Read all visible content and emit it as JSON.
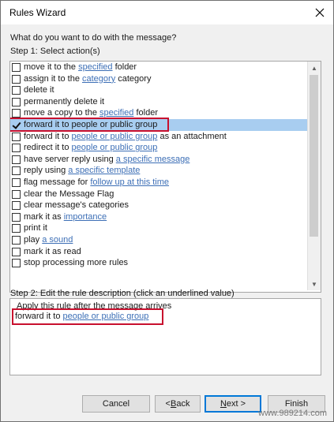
{
  "window": {
    "title": "Rules Wizard"
  },
  "question": "What do you want to do with the message?",
  "step1_label": "Step 1: Select action(s)",
  "actions": [
    {
      "pre": "move it to the ",
      "link": "specified",
      "post": " folder",
      "checked": false,
      "selected": false
    },
    {
      "pre": "assign it to the ",
      "link": "category",
      "post": " category",
      "checked": false,
      "selected": false
    },
    {
      "pre": "delete it",
      "link": "",
      "post": "",
      "checked": false,
      "selected": false
    },
    {
      "pre": "permanently delete it",
      "link": "",
      "post": "",
      "checked": false,
      "selected": false
    },
    {
      "pre": "move a copy to the ",
      "link": "specified",
      "post": " folder",
      "checked": false,
      "selected": false
    },
    {
      "pre": "forward it to people or public group",
      "link": "",
      "post": "",
      "checked": true,
      "selected": true
    },
    {
      "pre": "forward it to ",
      "link": "people or public group",
      "post": " as an attachment",
      "checked": false,
      "selected": false
    },
    {
      "pre": "redirect it to ",
      "link": "people or public group",
      "post": "",
      "checked": false,
      "selected": false
    },
    {
      "pre": "have server reply using ",
      "link": "a specific message",
      "post": "",
      "checked": false,
      "selected": false
    },
    {
      "pre": "reply using ",
      "link": "a specific template",
      "post": "",
      "checked": false,
      "selected": false
    },
    {
      "pre": "flag message for ",
      "link": "follow up at this time",
      "post": "",
      "checked": false,
      "selected": false
    },
    {
      "pre": "clear the Message Flag",
      "link": "",
      "post": "",
      "checked": false,
      "selected": false
    },
    {
      "pre": "clear message's categories",
      "link": "",
      "post": "",
      "checked": false,
      "selected": false
    },
    {
      "pre": "mark it as ",
      "link": "importance",
      "post": "",
      "checked": false,
      "selected": false
    },
    {
      "pre": "print it",
      "link": "",
      "post": "",
      "checked": false,
      "selected": false
    },
    {
      "pre": "play ",
      "link": "a sound",
      "post": "",
      "checked": false,
      "selected": false
    },
    {
      "pre": "mark it as read",
      "link": "",
      "post": "",
      "checked": false,
      "selected": false
    },
    {
      "pre": "stop processing more rules",
      "link": "",
      "post": "",
      "checked": false,
      "selected": false
    }
  ],
  "step2_label": "Step 2: Edit the rule description (click an underlined value)",
  "description": {
    "line1": "Apply this rule after the message arrives",
    "line2_pre": "forward it to ",
    "line2_link": "people or public group"
  },
  "buttons": {
    "cancel": "Cancel",
    "back_pre": "< ",
    "back_key": "B",
    "back_post": "ack",
    "next_key": "N",
    "next_post": "ext >",
    "finish": "Finish"
  },
  "watermark": "www.989214.com",
  "colors": {
    "selection": "#a8cdf0",
    "link": "#3d6fb6",
    "highlight": "#c8102e",
    "default_button": "#0078d7"
  }
}
